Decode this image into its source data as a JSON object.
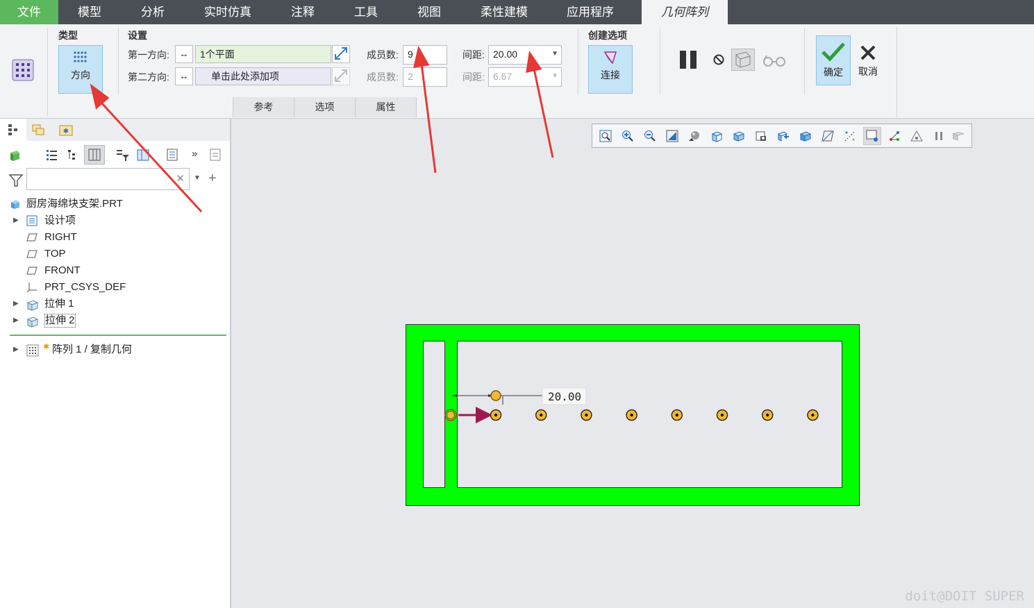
{
  "tabs": [
    "文件",
    "模型",
    "分析",
    "实时仿真",
    "注释",
    "工具",
    "视图",
    "柔性建模",
    "应用程序",
    "几何阵列"
  ],
  "ribbon": {
    "type_group": {
      "title": "类型",
      "button_label": "方向"
    },
    "settings_group": {
      "title": "设置",
      "dir1_label": "第一方向:",
      "dir1_value": "1个平面",
      "dir2_label": "第二方向:",
      "dir2_value": "单击此处添加项",
      "count1_label": "成员数:",
      "count1_value": "9",
      "count2_label": "成员数:",
      "count2_value": "2",
      "spacing1_label": "间距:",
      "spacing1_value": "20.00",
      "spacing2_label": "间距:",
      "spacing2_value": "6.67"
    },
    "options_group": {
      "title": "创建选项",
      "button_label": "连接"
    },
    "ok_label": "确定",
    "cancel_label": "取消",
    "subtabs": [
      "参考",
      "选项",
      "属性"
    ]
  },
  "model_tree": {
    "root": "厨房海绵块支架.PRT",
    "items": [
      "设计项",
      "RIGHT",
      "TOP",
      "FRONT",
      "PRT_CSYS_DEF",
      "拉伸 1",
      "拉伸 2"
    ],
    "pattern_item": "阵列 1 / 复制几何"
  },
  "canvas": {
    "dimension_label": "20.00",
    "pattern_member_count": 9
  },
  "watermark": "doit@DOIT SUPER",
  "colors": {
    "accent_green": "#5cb85c",
    "part_green": "#00ff00",
    "active_btn": "#c5e4f6",
    "arrow_red": "#e53935"
  }
}
